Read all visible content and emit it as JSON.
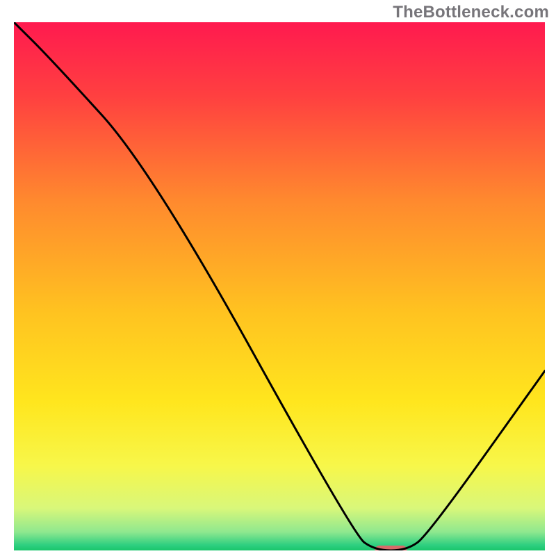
{
  "watermark": "TheBottleneck.com",
  "chart_data": {
    "type": "line",
    "title": "",
    "xlabel": "",
    "ylabel": "",
    "xlim": [
      0,
      100
    ],
    "ylim": [
      0,
      100
    ],
    "grid": false,
    "legend": false,
    "series": [
      {
        "name": "curve",
        "x": [
          0,
          7,
          26,
          64,
          68,
          74,
          78,
          100
        ],
        "values": [
          100,
          93,
          72,
          3,
          0,
          0,
          3,
          34
        ]
      }
    ],
    "marker": {
      "x_start": 68,
      "x_end": 74,
      "y": 0,
      "color": "#d66a6a"
    },
    "background_gradient": {
      "stops": [
        {
          "offset": 0,
          "color": "#ff1a4f"
        },
        {
          "offset": 0.14,
          "color": "#ff4040"
        },
        {
          "offset": 0.34,
          "color": "#ff8a2e"
        },
        {
          "offset": 0.55,
          "color": "#ffc320"
        },
        {
          "offset": 0.72,
          "color": "#ffe61e"
        },
        {
          "offset": 0.84,
          "color": "#f7f74a"
        },
        {
          "offset": 0.92,
          "color": "#d9f77a"
        },
        {
          "offset": 0.965,
          "color": "#8fe88f"
        },
        {
          "offset": 0.99,
          "color": "#2ecf80"
        },
        {
          "offset": 1.0,
          "color": "#19c66b"
        }
      ]
    }
  }
}
